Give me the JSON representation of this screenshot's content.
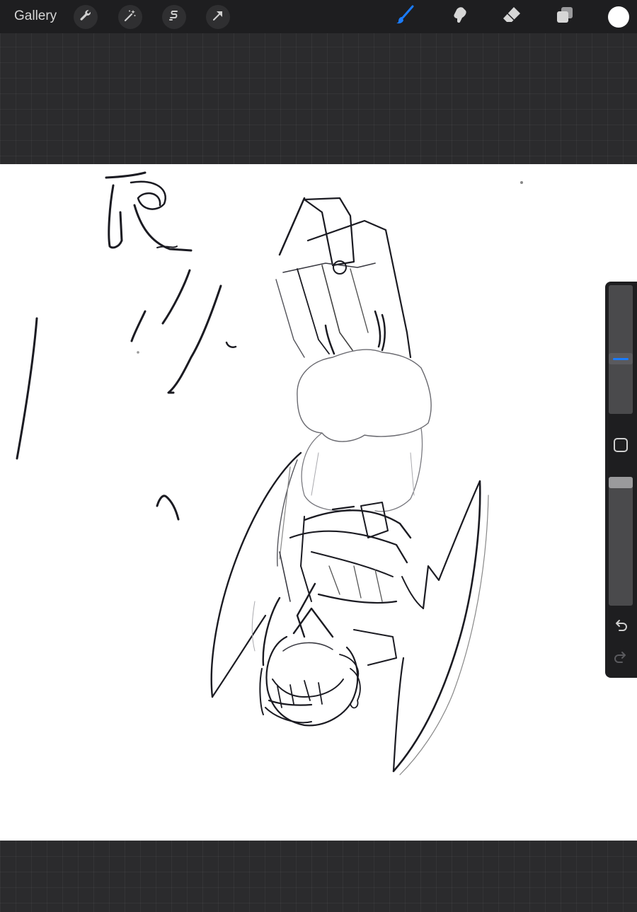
{
  "app": {
    "gallery_label": "Gallery"
  },
  "toolbar": {
    "left_tools": [
      {
        "name": "actions",
        "icon": "wrench-icon"
      },
      {
        "name": "adjustments",
        "icon": "magic-wand-icon"
      },
      {
        "name": "selection",
        "icon": "selection-s-icon"
      },
      {
        "name": "transform",
        "icon": "arrow-cursor-icon"
      }
    ],
    "right_tools": [
      {
        "name": "brush",
        "icon": "brush-icon",
        "active": true
      },
      {
        "name": "smudge",
        "icon": "smudge-icon",
        "active": false
      },
      {
        "name": "eraser",
        "icon": "eraser-icon",
        "active": false
      },
      {
        "name": "layers",
        "icon": "layers-icon",
        "active": false
      }
    ],
    "active_color": "#ffffff",
    "accent_color": "#1a7cff"
  },
  "sidebar": {
    "brush_size_level": 0.42,
    "opacity_level": 1.0,
    "modify_icon": "square-modify-icon",
    "undo_icon": "undo-icon",
    "redo_icon": "redo-icon",
    "redo_enabled": false
  }
}
